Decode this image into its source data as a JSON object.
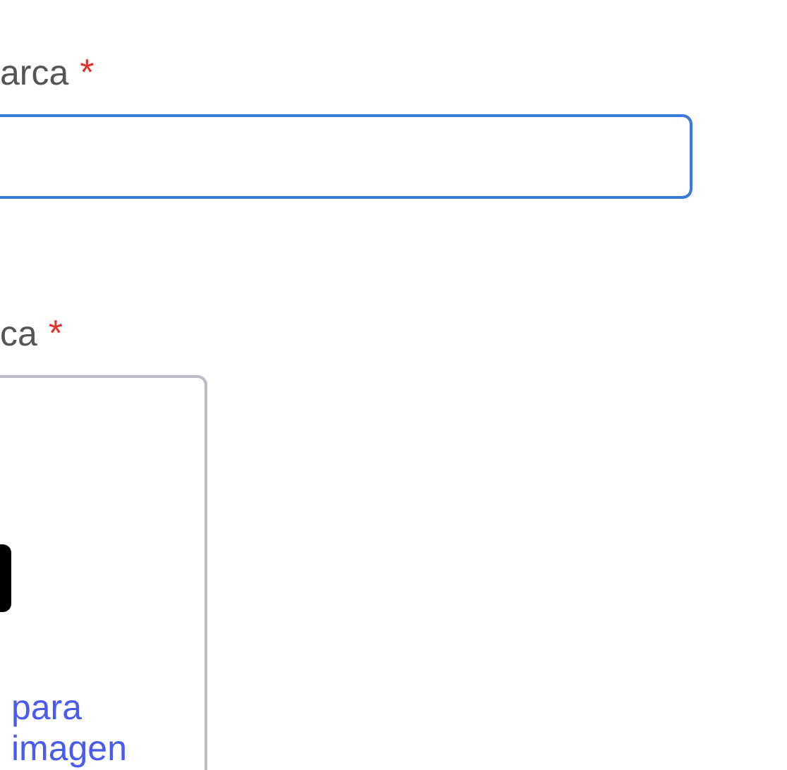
{
  "fields": [
    {
      "kind": "text",
      "label": "arca",
      "required_mark": "*",
      "focused": true
    },
    {
      "kind": "upload",
      "label": "ca",
      "required_mark": "*",
      "lines": [
        "para",
        "imagen"
      ]
    }
  ]
}
